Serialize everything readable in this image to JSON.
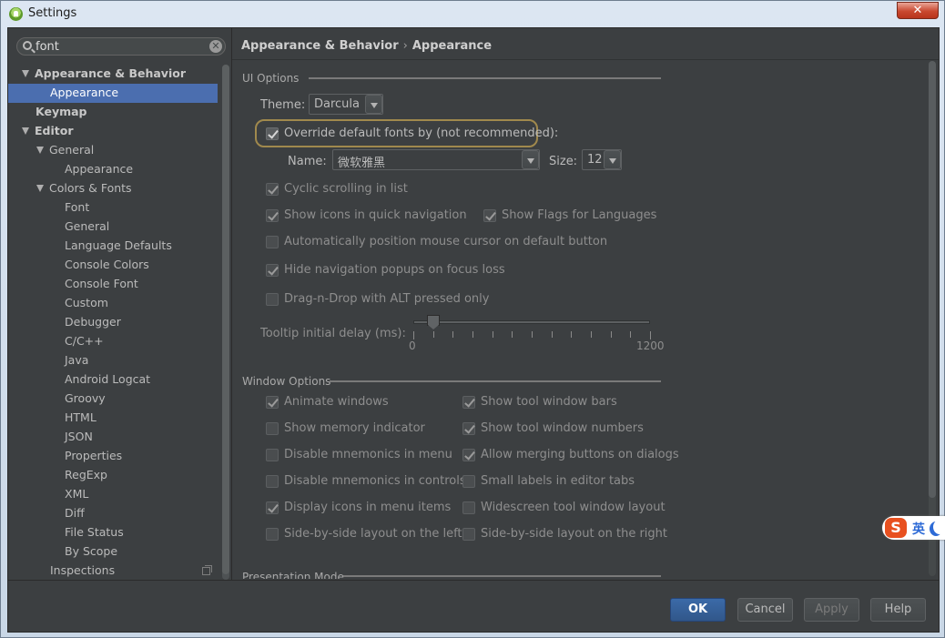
{
  "window": {
    "title": "Settings",
    "close_glyph": "✕"
  },
  "search": {
    "value": "font",
    "clear_glyph": "✕"
  },
  "tree": [
    {
      "label": "Appearance & Behavior",
      "level": 0,
      "arrow": true,
      "bold": true
    },
    {
      "label": "Appearance",
      "level": 1,
      "selected": true
    },
    {
      "label": "Keymap",
      "level": 0,
      "bold": true
    },
    {
      "label": "Editor",
      "level": 0,
      "arrow": true,
      "bold": true
    },
    {
      "label": "General",
      "level": 1,
      "arrow": true
    },
    {
      "label": "Appearance",
      "level": 2
    },
    {
      "label": "Colors & Fonts",
      "level": 1,
      "arrow": true
    },
    {
      "label": "Font",
      "level": 2
    },
    {
      "label": "General",
      "level": 2
    },
    {
      "label": "Language Defaults",
      "level": 2
    },
    {
      "label": "Console Colors",
      "level": 2
    },
    {
      "label": "Console Font",
      "level": 2
    },
    {
      "label": "Custom",
      "level": 2
    },
    {
      "label": "Debugger",
      "level": 2
    },
    {
      "label": "C/C++",
      "level": 2
    },
    {
      "label": "Java",
      "level": 2
    },
    {
      "label": "Android Logcat",
      "level": 2
    },
    {
      "label": "Groovy",
      "level": 2
    },
    {
      "label": "HTML",
      "level": 2
    },
    {
      "label": "JSON",
      "level": 2
    },
    {
      "label": "Properties",
      "level": 2
    },
    {
      "label": "RegExp",
      "level": 2
    },
    {
      "label": "XML",
      "level": 2
    },
    {
      "label": "Diff",
      "level": 2
    },
    {
      "label": "File Status",
      "level": 2
    },
    {
      "label": "By Scope",
      "level": 2
    },
    {
      "label": "Inspections",
      "level": 1
    }
  ],
  "breadcrumb": {
    "parent": "Appearance & Behavior",
    "separator": "›",
    "current": "Appearance"
  },
  "ui_options": {
    "group_title": "UI Options",
    "theme_label": "Theme:",
    "theme_value": "Darcula",
    "override_fonts": {
      "label": "Override default fonts by (not recommended):",
      "checked": true
    },
    "name_label": "Name:",
    "name_value": "微软雅黑",
    "size_label": "Size:",
    "size_value": "12",
    "cyclic_scrolling": {
      "label": "Cyclic scrolling in list",
      "checked": true
    },
    "show_icons_quick_nav": {
      "label": "Show icons in quick navigation",
      "checked": true
    },
    "show_flags": {
      "label": "Show Flags for Languages",
      "checked": true
    },
    "auto_position_mouse": {
      "label": "Automatically position mouse cursor on default button",
      "checked": false
    },
    "hide_nav_popups": {
      "label": "Hide navigation popups on focus loss",
      "checked": true
    },
    "drag_n_drop_alt": {
      "label": "Drag-n-Drop with ALT pressed only",
      "checked": false
    },
    "tooltip_label": "Tooltip initial delay (ms):",
    "tooltip_min": "0",
    "tooltip_max": "1200",
    "tooltip_value_fraction": 0.08
  },
  "window_options": {
    "group_title": "Window Options",
    "left": [
      {
        "label": "Animate windows",
        "checked": true
      },
      {
        "label": "Show memory indicator",
        "checked": false
      },
      {
        "label": "Disable mnemonics in menu",
        "checked": false
      },
      {
        "label": "Disable mnemonics in controls",
        "checked": false
      },
      {
        "label": "Display icons in menu items",
        "checked": true
      },
      {
        "label": "Side-by-side layout on the left",
        "checked": false
      }
    ],
    "right": [
      {
        "label": "Show tool window bars",
        "checked": true
      },
      {
        "label": "Show tool window numbers",
        "checked": true
      },
      {
        "label": "Allow merging buttons on dialogs",
        "checked": true
      },
      {
        "label": "Small labels in editor tabs",
        "checked": false
      },
      {
        "label": "Widescreen tool window layout",
        "checked": false
      },
      {
        "label": "Side-by-side layout on the right",
        "checked": false
      }
    ]
  },
  "presentation_mode": {
    "group_title": "Presentation Mode"
  },
  "buttons": {
    "ok": "OK",
    "cancel": "Cancel",
    "apply": "Apply",
    "help": "Help"
  },
  "ime": {
    "logo": "S",
    "mode": "英"
  },
  "colors": {
    "background": "#3c3f41",
    "selection": "#4b6eaf",
    "primary_button": "#365f98",
    "focus_ring": "#a0894d"
  }
}
